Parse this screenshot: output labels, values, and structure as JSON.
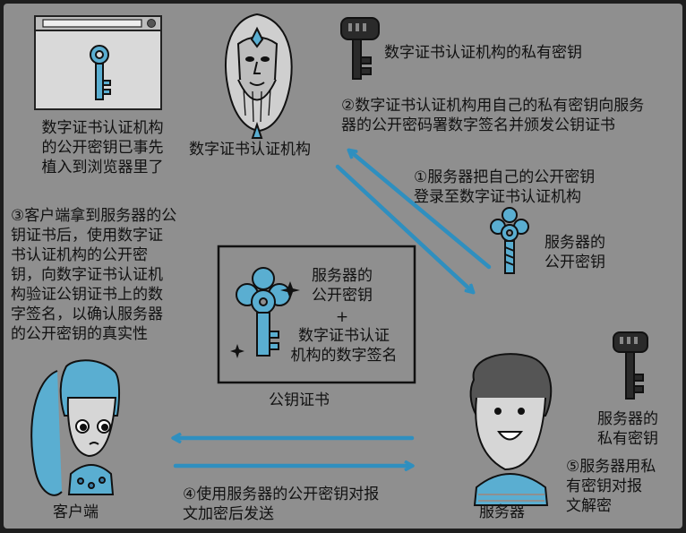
{
  "labels": {
    "browser_note": "数字证书认证机构\n的公开密钥已事先\n植入到浏览器里了",
    "ca_name": "数字证书认证机构",
    "ca_private_key": "数字证书认证机构的私有密钥",
    "step2": "②数字证书认证机构用自己的私有密钥向服务\n器的公开密码署数字签名并颁发公钥证书",
    "step1": "①服务器把自己的公开密钥\n登录至数字证书认证机构",
    "step3": "③客户端拿到服务器的公\n钥证书后，使用数字证\n书认证机构的公开密\n钥，向数字证书认证机\n构验证公钥证书上的数\n字签名，以确认服务器\n的公开密钥的真实性",
    "server_public_key": "服务器的\n公开密钥",
    "cert_content_key": "服务器的\n公开密钥",
    "cert_plus": "+",
    "cert_content_sig": "数字证书认证\n机构的数字签名",
    "cert_label": "公钥证书",
    "server_private_key": "服务器的\n私有密钥",
    "step4": "④使用服务器的公开密钥对报\n文加密后发送",
    "step5": "⑤服务器用私\n有密钥对报\n文解密",
    "client": "客户端",
    "server": "服务器"
  },
  "colors": {
    "background": "#8f8f8f",
    "arrow_blue": "#2f8fbf",
    "key_blue": "#5aaed1",
    "ink": "#111111"
  },
  "icons": [
    "browser-window-icon",
    "ca-key-icon",
    "ca-private-key-icon",
    "server-public-key-icon",
    "cert-key-icon",
    "server-private-key-icon",
    "ca-person-icon",
    "client-person-icon",
    "server-person-icon"
  ]
}
